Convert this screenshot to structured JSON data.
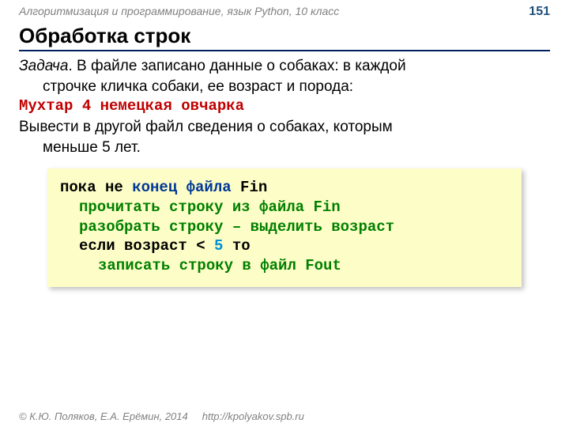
{
  "header": {
    "course": "Алгоритмизация и программирование, язык Python, 10 класс",
    "page": "151"
  },
  "title": "Обработка строк",
  "task": {
    "label": "Задача",
    "period": ". ",
    "text_line1": "В файле записано данные о собаках: в каждой",
    "text_line2": "строчке кличка собаки, ее возраст и порода:",
    "sample": "Мухтар 4 немецкая овчарка",
    "text_line3": "Вывести в другой файл сведения о собаках, которым",
    "text_line4": "меньше 5 лет."
  },
  "code": {
    "l1a": "пока не ",
    "l1b": "конец файла",
    "l1c": " Fin",
    "l2a": "прочитать строку из файла Fin",
    "l3a": "разобрать строку – выделить возраст",
    "l4a": "если возраст < ",
    "l4b": "5",
    "l4c": " то",
    "l5a": "записать строку в файл Fout"
  },
  "footer": {
    "copyright": "© К.Ю. Поляков, Е.А. Ерёмин, 2014",
    "url": "http://kpolyakov.spb.ru"
  }
}
